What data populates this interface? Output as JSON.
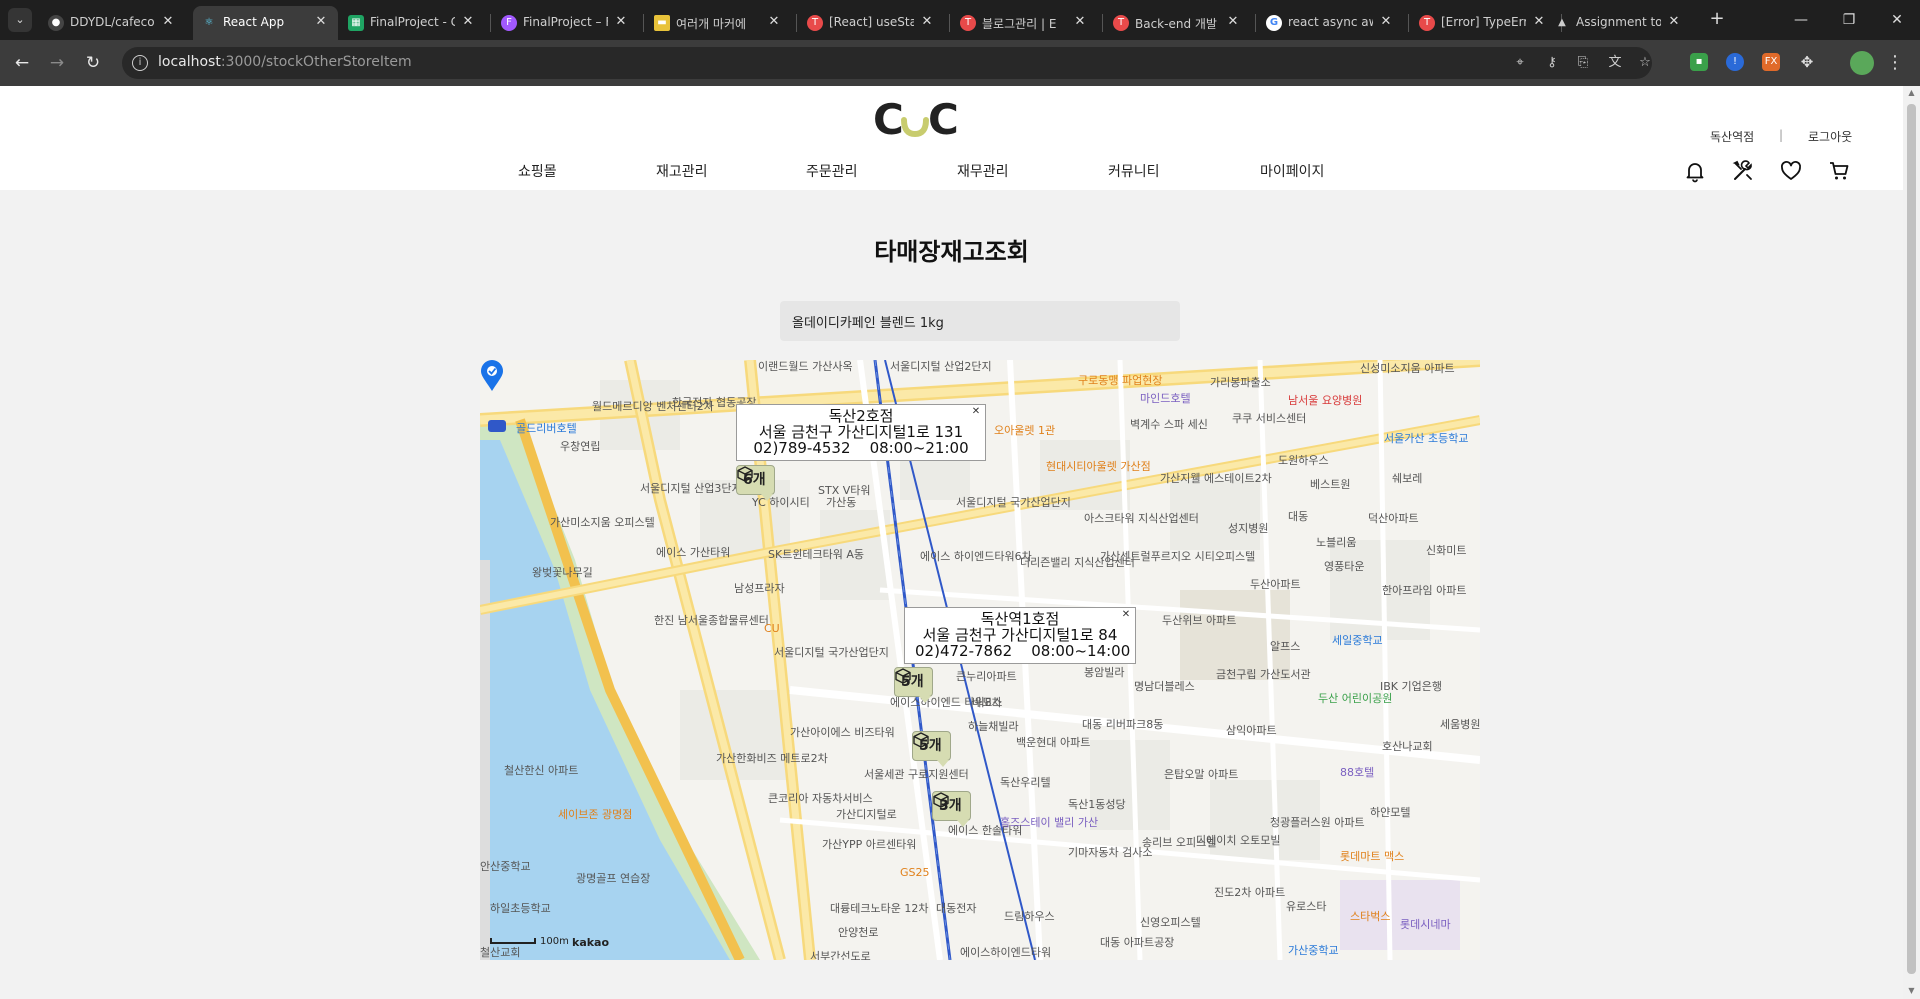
{
  "browser": {
    "tabs": [
      {
        "title": "DDYDL/cafeco",
        "icon": "github-icon",
        "active": false
      },
      {
        "title": "React App",
        "icon": "react-icon",
        "active": true
      },
      {
        "title": "FinalProject - G",
        "icon": "sheets-icon",
        "active": false
      },
      {
        "title": "FinalProject – F",
        "icon": "figma-icon",
        "active": false
      },
      {
        "title": "여러개 마커에",
        "icon": "folder-icon",
        "active": false
      },
      {
        "title": "[React] useStat",
        "icon": "tistory-icon",
        "active": false
      },
      {
        "title": "블로그관리 | E",
        "icon": "tistory-icon",
        "active": false
      },
      {
        "title": "Back-end 개발",
        "icon": "tistory-icon",
        "active": false
      },
      {
        "title": "react async aw",
        "icon": "google-icon",
        "active": false
      },
      {
        "title": "[Error] TypeErr",
        "icon": "tistory-icon",
        "active": false
      },
      {
        "title": "Assignment to",
        "icon": "lock-icon",
        "active": false
      }
    ],
    "url_host": "localhost",
    "url_path": ":3000/stockOtherStoreItem"
  },
  "header": {
    "logo_text": "CuC",
    "store_name": "독산역점",
    "divider": "|",
    "logout_label": "로그아웃",
    "nav": [
      "쇼핑몰",
      "재고관리",
      "주문관리",
      "재무관리",
      "커뮤니티",
      "마이페이지"
    ]
  },
  "main": {
    "title": "타매장재고조회",
    "search_value": "올데이디카페인 블렌드 1kg"
  },
  "map": {
    "info_windows": [
      {
        "name": "독산2호점",
        "address": "서울 금천구 가산디지털1로 131",
        "phone_hours": "02)789-4532    08:00~21:00"
      },
      {
        "name": "독산역1호점",
        "address": "서울 금천구 가산디지털1로 84",
        "phone_hours": "02)472-7862    08:00~14:00"
      }
    ],
    "markers": [
      "6개",
      "5개",
      "5개",
      "3개"
    ],
    "scale_label": "100m",
    "attribution": "kakao",
    "labels": [
      "이랜드월드 가산사옥",
      "서울디지털 산업2단지",
      "월드메르디앙 벤처센터2차",
      "한국전자 협동공장",
      "골드리버호텔",
      "우창연립",
      "서울디지털 산업3단지",
      "가산미소지움 오피스텔",
      "에이스 가산타워",
      "왕벚꽃나무길",
      "STX V타워",
      "가산동",
      "YC 하이시티",
      "SK트윈테크타워 A동",
      "남성프라자",
      "한진 남서울종합물류센터",
      "CU",
      "서울디지털 국가산업단지",
      "가산아이에스 비즈타워",
      "가산한화비즈 메트로2차",
      "철산한신 아파트",
      "세이브존 광명점",
      "안산중학교",
      "하일초등학교",
      "광명골프 연습장",
      "철산교회",
      "큰누리아파트",
      "에이스하이엔드 타워8차",
      "바모스",
      "하늘채빌라",
      "백운현대 아파트",
      "독산우리텔",
      "서울세관 구로지원센터",
      "큰코리아 자동차서비스",
      "가산YPP 아르센타워",
      "GS25",
      "에이스 한솔타워",
      "대륭테크노타운 12차",
      "대동전자",
      "홈즈스테이 밸리 가산",
      "드림하우스",
      "에이스하이엔드타워",
      "서울디지털 국가산업단지",
      "에이스 하이엔드타워6차",
      "더리즌밸리 지식산업센터",
      "가산센트럴푸르지오 시티오피스텔",
      "아스크타워 지식산업센터",
      "가산지웰 에스테이트2차",
      "벽계수 스파 세신",
      "마인드호텔",
      "구로동맹 파업현장",
      "현대시티아울렛 가산점",
      "오아울렛 1관",
      "가리봉파출소",
      "쿠쿠 서비스센터",
      "남서울 요양병원",
      "신성미소지움 아파트",
      "서울가산 초등학교",
      "도원하우스",
      "베스트원",
      "쉐보레",
      "덕산아파트",
      "대동",
      "성지병원",
      "노블리움",
      "영풍타운",
      "신화미트",
      "한아프라임 아파트",
      "두산아파트",
      "두산위브 아파트",
      "알프스",
      "세일중학교",
      "봉암빌라",
      "명남더블레스",
      "금천구립 가산도서관",
      "두산 어린이공원",
      "IBK 기업은행",
      "대동 리버파크8동",
      "삼익아파트",
      "호산나교회",
      "세움병원 본관",
      "88호텔",
      "은탑오말 아파트",
      "독산1동성당",
      "기마자동차 검사소",
      "송리브 오피스텔",
      "디에이치 오토모빌",
      "진도2차 아파트",
      "청광플러스원 아파트",
      "하얀모텔",
      "롯데마트 맥스",
      "유로스타",
      "스타벅스",
      "롯데시네마",
      "가산중학교",
      "신영오피스텔",
      "대동 아파트공장",
      "서부간선도로",
      "안양천로",
      "가산디지털로"
    ]
  },
  "colors": {
    "accent_logo": "#c8cc6e",
    "marker_bg": "#d6dcb2",
    "river": "#a7d3f0",
    "subway": "#3058c8"
  }
}
